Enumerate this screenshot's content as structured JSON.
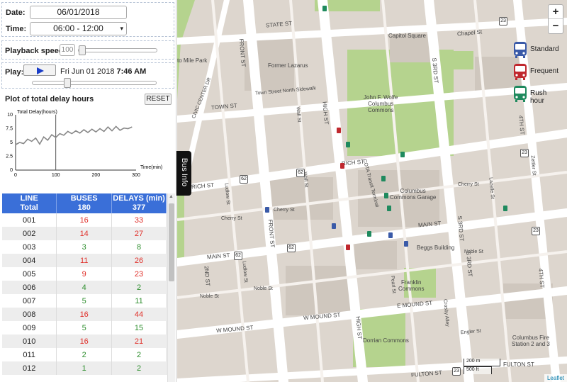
{
  "controls": {
    "date_label": "Date:",
    "date_value": "06/01/2018",
    "time_label": "Time:",
    "time_value": "06:00 - 12:00",
    "speed_label": "Playback speed:",
    "speed_value": "100",
    "play_label": "Play:",
    "play_time_prefix": "Fri Jun 01 2018",
    "play_time_bold": "7:46 AM"
  },
  "plot": {
    "title": "Plot of total delay hours",
    "reset_label": "RESET"
  },
  "chart_data": {
    "type": "line",
    "ylabel": "Total Delay(hours)",
    "xlabel": "Time(min)",
    "x_ticks": [
      "0",
      "100",
      "200",
      "300"
    ],
    "y_ticks": [
      "0",
      "2.5",
      "5",
      "7.5",
      "10"
    ],
    "xlim": [
      0,
      300
    ],
    "ylim": [
      0,
      10
    ],
    "current_time_marker": 100,
    "series": [
      {
        "x": [
          0,
          10,
          20,
          30,
          40,
          50,
          60,
          70,
          80,
          90,
          100,
          110,
          120,
          130,
          140,
          150,
          160,
          170,
          180,
          190,
          200,
          210,
          220,
          230,
          240,
          250,
          260,
          270,
          280,
          290
        ],
        "values": [
          4.6,
          5.0,
          4.8,
          5.6,
          5.2,
          5.8,
          4.7,
          6.0,
          5.4,
          6.4,
          5.9,
          6.6,
          6.3,
          7.0,
          6.6,
          7.1,
          6.7,
          7.3,
          6.8,
          7.4,
          6.9,
          7.5,
          7.0,
          7.8,
          7.1,
          7.9,
          7.2,
          7.6,
          7.5,
          7.8
        ]
      }
    ]
  },
  "table": {
    "headers": [
      {
        "title": "LINE",
        "sub": "Total"
      },
      {
        "title": "BUSES",
        "sub": "180"
      },
      {
        "title": "DELAYS (min)",
        "sub": "377"
      }
    ],
    "rows": [
      [
        "001",
        "16",
        "33"
      ],
      [
        "002",
        "14",
        "27"
      ],
      [
        "003",
        "3",
        "8"
      ],
      [
        "004",
        "11",
        "26"
      ],
      [
        "005",
        "9",
        "23"
      ],
      [
        "006",
        "4",
        "2"
      ],
      [
        "007",
        "5",
        "11"
      ],
      [
        "008",
        "16",
        "44"
      ],
      [
        "009",
        "5",
        "15"
      ],
      [
        "010",
        "16",
        "21"
      ],
      [
        "011",
        "2",
        "2"
      ],
      [
        "012",
        "1",
        "2"
      ]
    ],
    "row_colors": [
      "red",
      "red",
      "grn",
      "red",
      "red",
      "grn",
      "grn",
      "red",
      "grn",
      "red",
      "grn",
      "grn"
    ]
  },
  "map": {
    "tab_label": "Bus Info",
    "zoom_in": "+",
    "zoom_out": "−",
    "legend": [
      {
        "label": "Standard",
        "color": "#3a5aa8"
      },
      {
        "label": "Frequent",
        "color": "#c0282e"
      },
      {
        "label": "Rush hour",
        "color": "#1f8a5e"
      }
    ],
    "scale_m": "200 m",
    "scale_ft": "500 ft",
    "attribution": "Leaflet",
    "labels": {
      "state_st": "STATE ST",
      "capitol_square": "Capitol Square",
      "chapel_st": "Chapel St",
      "bicentennial": "to Mile Park",
      "former_lazarus": "Former Lazarus",
      "town_st": "TOWN ST",
      "town_st_walk": "Town Street North Sidewalk",
      "john_wolfe": "John F. Wolfe\nColumbus\nCommons",
      "rich_st": "RICH ST",
      "main_st": "MAIN ST",
      "mound_st": "W MOUND ST",
      "e_mound_st": "E MOUND ST",
      "fulton_st": "FULTON ST",
      "front_st": "FRONT ST",
      "high_st": "HIGH ST",
      "s3rd": "S 3RD ST",
      "s4th": "4TH ST",
      "civic": "CIVIC CENTER DR",
      "garage": "Columbus\nCommons Garage",
      "beggs": "Beggs Building",
      "franklin": "Franklin\nCommons",
      "dorrian": "Dorrian Commons",
      "fire": "Columbus Fire\nStation 2 and 3",
      "s2nd": "2ND ST",
      "cherry": "Cherry St",
      "noble": "Noble St",
      "ludlow": "Ludlow St",
      "wall": "Wall St",
      "pearl": "Pearl St",
      "lazelle": "Lazelle St",
      "zettler": "Zettler St",
      "crosby": "Crosby Alley",
      "engler": "Engler St",
      "cota": "COTA Transit Terminal",
      "s3rd_b": "S 3RD ST",
      "fulton_e": "FULTON ST"
    }
  }
}
